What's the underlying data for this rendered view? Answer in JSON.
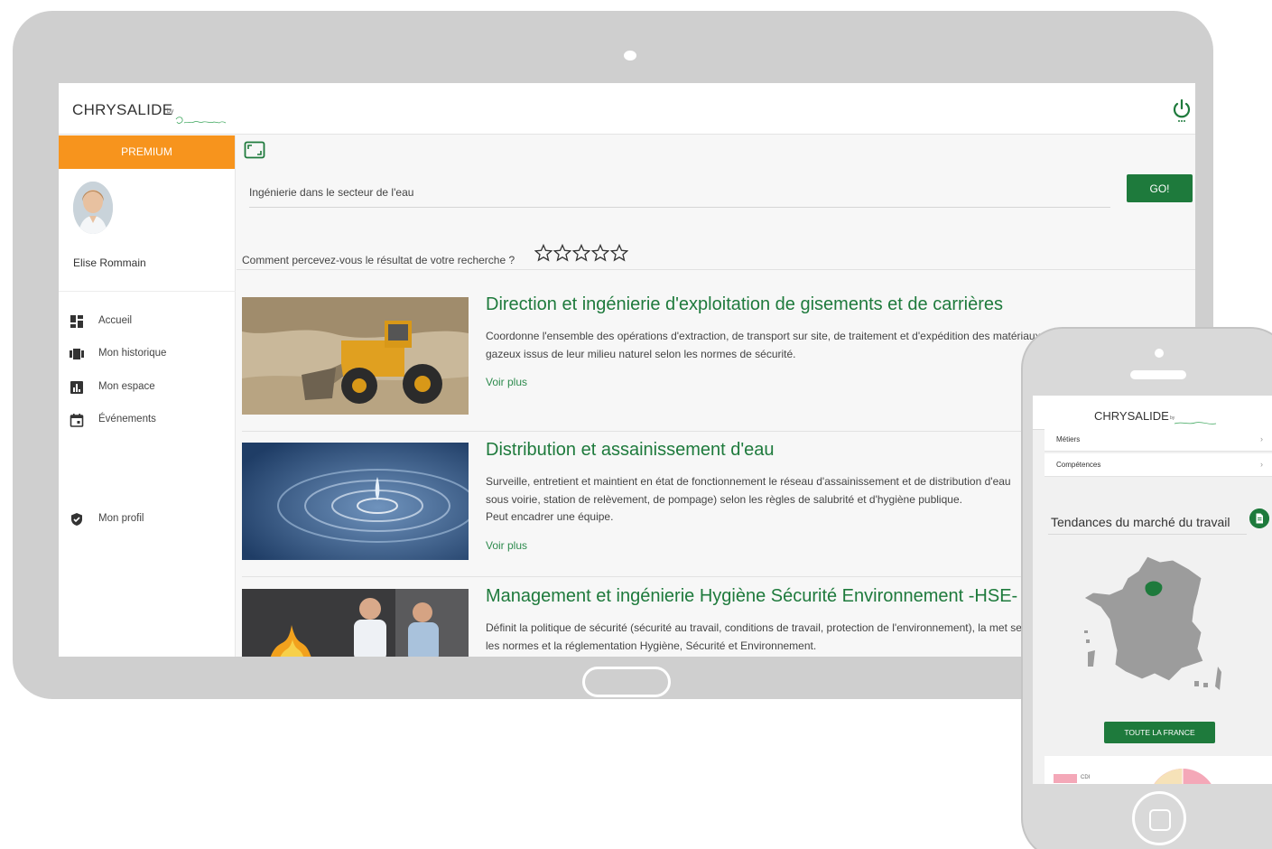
{
  "tablet": {
    "app": {
      "logo_text": "CHRYSALIDE",
      "logo_by": "by"
    },
    "sidebar": {
      "premium_label": "PREMIUM",
      "user_name": "Elise Rommain",
      "items": [
        {
          "label": "Accueil",
          "icon": "dashboard-icon"
        },
        {
          "label": "Mon historique",
          "icon": "history-icon"
        },
        {
          "label": "Mon espace",
          "icon": "bar-chart-icon"
        },
        {
          "label": "Événements",
          "icon": "calendar-icon"
        },
        {
          "label": "Mon profil",
          "icon": "shield-icon"
        }
      ]
    },
    "search": {
      "value": "Ingénierie dans le secteur de l'eau",
      "go_label": "GO!"
    },
    "rating": {
      "question": "Comment percevez-vous le résultat de votre recherche ?",
      "stars_total": 5,
      "stars_filled": 0
    },
    "results": [
      {
        "title": "Direction et ingénierie d'exploitation de gisements et de carrières",
        "description": "Coordonne l'ensemble des opérations d'extraction, de transport sur site, de traitement et d'expédition des matériaux solides, liquides ou gazeux issus de leur milieu naturel selon les normes de sécurité.",
        "more": "Voir plus"
      },
      {
        "title": "Distribution et assainissement d'eau",
        "description_lines": [
          "Surveille, entretient et maintient en état de fonctionnement le réseau d'assainissement et de distribution d'eau",
          "sous voirie, station de relèvement, de pompage) selon les règles de salubrité et d'hygiène publique.",
          "Peut encadrer une équipe."
        ],
        "more": "Voir plus"
      },
      {
        "title": "Management et ingénierie Hygiène Sécurité Environnement -HSE- i",
        "description": "Définit la politique de sécurité (sécurité au travail, conditions de travail, protection de l'environnement), la met selon les normes et la réglementation Hygiène, Sécurité et Environnement."
      }
    ]
  },
  "phone": {
    "logo_text": "CHRYSALIDE",
    "logo_by": "by",
    "menu": [
      {
        "label": "Métiers"
      },
      {
        "label": "Compétences"
      }
    ],
    "trends_title": "Tendances du marché du travail",
    "france_button": "TOUTE LA FRANCE",
    "legend_label": "CDI"
  },
  "colors": {
    "brand_green": "#1e7a3c",
    "premium_orange": "#f7941d",
    "link_green": "#2e8b4e"
  }
}
